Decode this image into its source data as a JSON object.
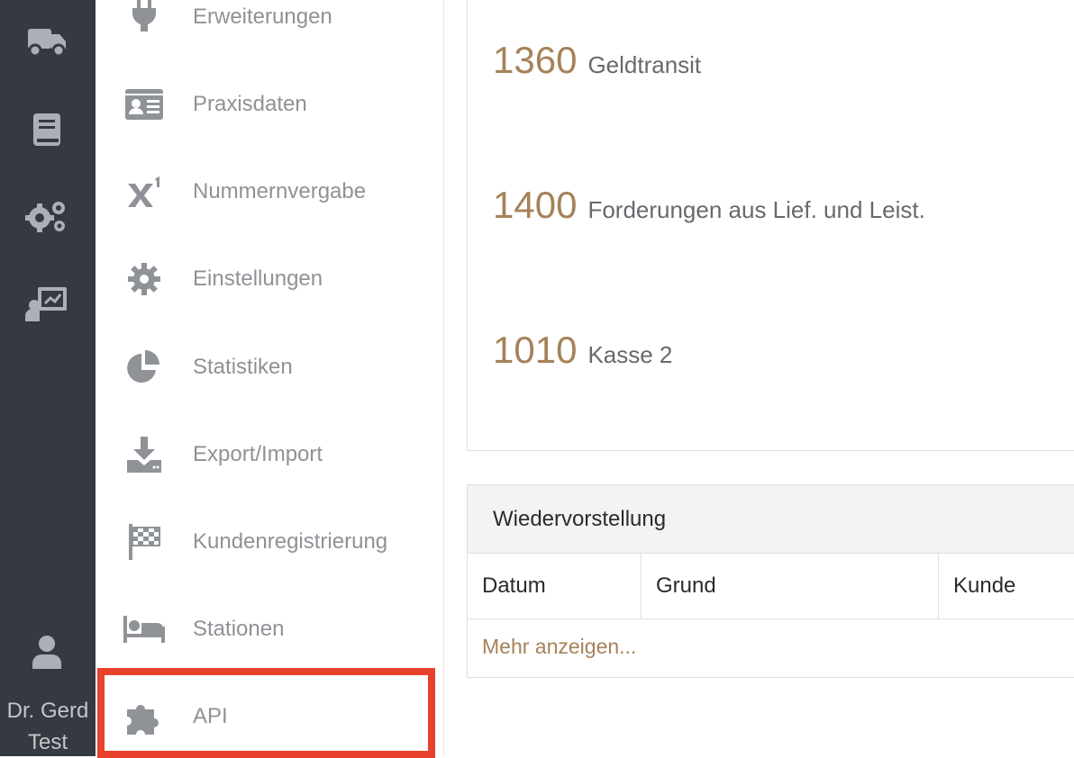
{
  "rail": {
    "icons": [
      "truck-icon",
      "book-icon",
      "gears-icon",
      "chalkboard-teacher-icon"
    ],
    "user_name": "Dr. Gerd Test"
  },
  "menu": {
    "items": [
      {
        "label": "Erweiterungen",
        "icon": "plug-icon"
      },
      {
        "label": "Praxisdaten",
        "icon": "id-card-icon"
      },
      {
        "label": "Nummernvergabe",
        "icon": "superscript-icon"
      },
      {
        "label": "Einstellungen",
        "icon": "gear-icon"
      },
      {
        "label": "Statistiken",
        "icon": "pie-chart-icon"
      },
      {
        "label": "Export/Import",
        "icon": "download-icon"
      },
      {
        "label": "Kundenregistrierung",
        "icon": "checkered-flag-icon"
      },
      {
        "label": "Stationen",
        "icon": "bed-icon"
      },
      {
        "label": "API",
        "icon": "puzzle-piece-icon"
      }
    ],
    "highlighted_item": "API",
    "highlight_color": "#e8412c"
  },
  "accounts": [
    {
      "number": "1360",
      "name": "Geldtransit"
    },
    {
      "number": "1400",
      "name": "Forderungen aus Lief. und Leist."
    },
    {
      "number": "1010",
      "name": "Kasse 2"
    }
  ],
  "wiedervorstellung": {
    "title": "Wiedervorstellung",
    "columns": [
      "Datum",
      "Grund",
      "Kunde"
    ],
    "more_link": "Mehr anzeigen..."
  },
  "colors": {
    "rail_bg": "#343a40",
    "accent": "#a5825a",
    "menu_text": "#8e9296"
  }
}
